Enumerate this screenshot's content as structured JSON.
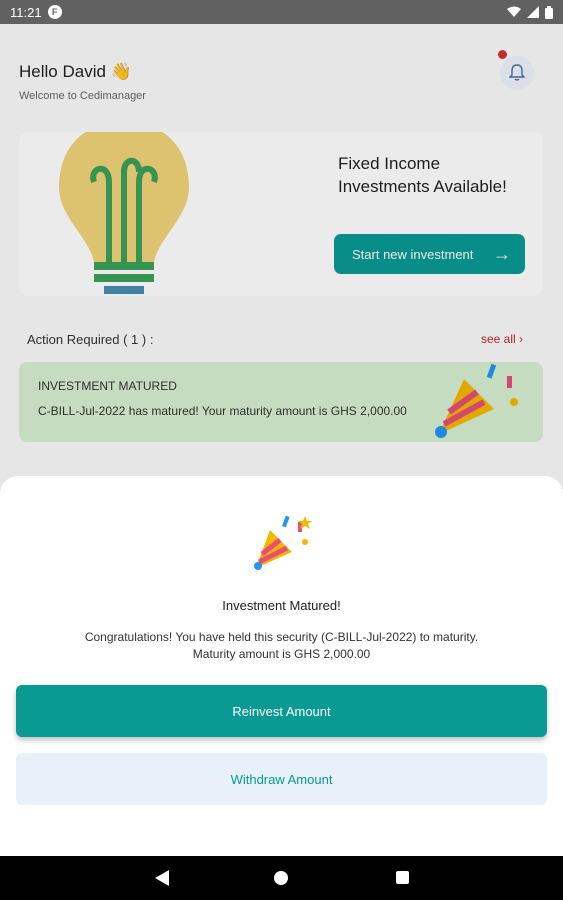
{
  "status_bar": {
    "time": "11:21",
    "badge_letter": "F",
    "icons": [
      "wifi-icon",
      "signal-icon",
      "battery-icon"
    ]
  },
  "header": {
    "greeting": "Hello David 👋",
    "subtitle": "Welcome to Cedimanager",
    "icon": "bell-icon"
  },
  "promo": {
    "title": "Fixed Income Investments Available!",
    "button_label": "Start new investment",
    "button_icon": "arrow-right-icon"
  },
  "actions": {
    "title": "Action Required ( 1 ) :",
    "see_all": "see all"
  },
  "alert": {
    "title": "INVESTMENT MATURED",
    "text": "C-BILL-Jul-2022 has matured! Your maturity amount is GHS 2,000.00"
  },
  "sheet": {
    "title": "Investment Matured!",
    "message_line1": "Congratulations! You have held this security (C-BILL-Jul-2022) to maturity.",
    "message_line2": "Maturity amount is GHS 2,000.00",
    "reinvest_label": "Reinvest Amount",
    "withdraw_label": "Withdraw Amount"
  },
  "colors": {
    "accent": "#0a9a94",
    "alert_bg": "#d7efd2",
    "withdraw_bg": "#e8f0fa",
    "danger": "#c62828"
  }
}
